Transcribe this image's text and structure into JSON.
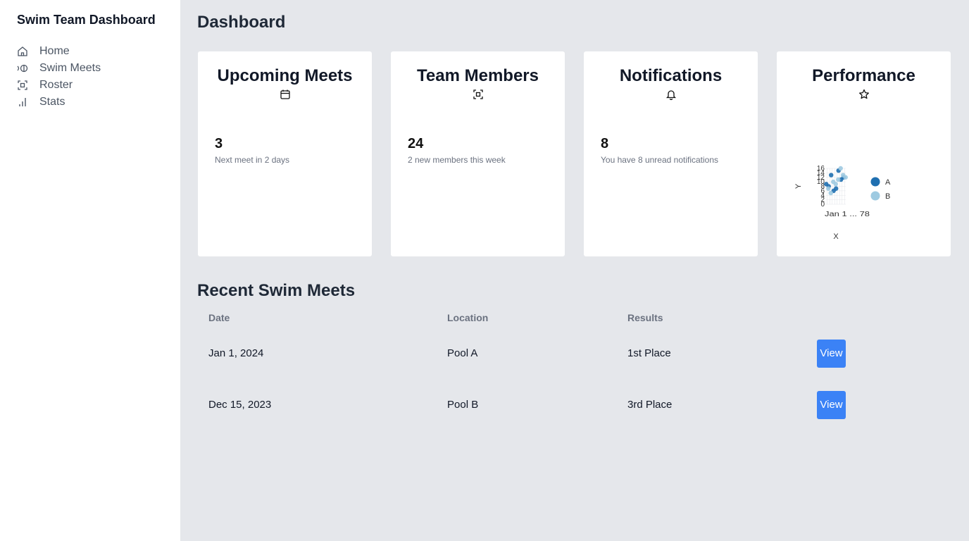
{
  "app": {
    "title": "Swim Team Dashboard"
  },
  "sidebar": {
    "items": [
      {
        "label": "Home",
        "icon": "home-icon"
      },
      {
        "label": "Swim Meets",
        "icon": "swim-icon"
      },
      {
        "label": "Roster",
        "icon": "roster-icon"
      },
      {
        "label": "Stats",
        "icon": "stats-icon"
      }
    ]
  },
  "main": {
    "title": "Dashboard"
  },
  "cards": [
    {
      "title": "Upcoming Meets",
      "icon": "calendar-icon",
      "value": "3",
      "subtitle": "Next meet in 2 days"
    },
    {
      "title": "Team Members",
      "icon": "scan-face-icon",
      "value": "24",
      "subtitle": "2 new members this week"
    },
    {
      "title": "Notifications",
      "icon": "bell-icon",
      "value": "8",
      "subtitle": "You have 8 unread notifications"
    },
    {
      "title": "Performance",
      "icon": "star-icon"
    }
  ],
  "chart_data": {
    "type": "scatter",
    "title": "",
    "xlabel": "X",
    "ylabel": "Y",
    "ylim": [
      0,
      16
    ],
    "yticks": [
      "0",
      "2",
      "4",
      "6",
      "8",
      "10",
      "12",
      "14",
      "16"
    ],
    "xticks_text": "Jan 1 ... 78",
    "legend_position": "right",
    "series": [
      {
        "name": "A",
        "color": "#1f6fb0",
        "values": [
          9,
          8,
          13,
          6,
          7,
          15,
          11,
          12
        ]
      },
      {
        "name": "B",
        "color": "#9ecae1",
        "values": [
          7,
          5,
          10,
          9,
          11,
          16,
          13,
          12
        ]
      }
    ]
  },
  "recent": {
    "title": "Recent Swim Meets",
    "columns": [
      "Date",
      "Location",
      "Results",
      ""
    ],
    "rows": [
      {
        "date": "Jan 1, 2024",
        "location": "Pool A",
        "result": "1st Place",
        "action": "View"
      },
      {
        "date": "Dec 15, 2023",
        "location": "Pool B",
        "result": "3rd Place",
        "action": "View"
      }
    ]
  }
}
